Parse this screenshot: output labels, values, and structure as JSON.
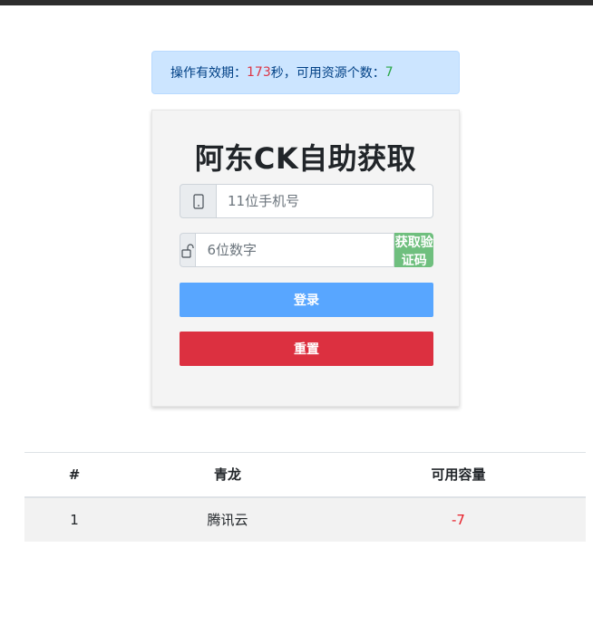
{
  "notice": {
    "prefix": "操作有效期：",
    "seconds": "173",
    "middle": "秒，可用资源个数：",
    "resources": "7"
  },
  "login_card": {
    "title": "阿东CK自助获取",
    "phone_placeholder": "11位手机号",
    "code_placeholder": "6位数字",
    "get_code_label": "获取验证码",
    "login_label": "登录",
    "reset_label": "重置",
    "phone_icon": "mobile-phone-icon",
    "lock_icon": "unlock-icon"
  },
  "table": {
    "headers": [
      "#",
      "青龙",
      "可用容量"
    ],
    "rows": [
      {
        "index": "1",
        "name": "腾讯云",
        "capacity": "-7"
      }
    ]
  },
  "colors": {
    "notice_bg": "#cce5ff",
    "login_btn": "#58a6ff",
    "reset_btn": "#dc3040",
    "code_btn": "#6fbf7e",
    "negative": "#e8202a"
  }
}
